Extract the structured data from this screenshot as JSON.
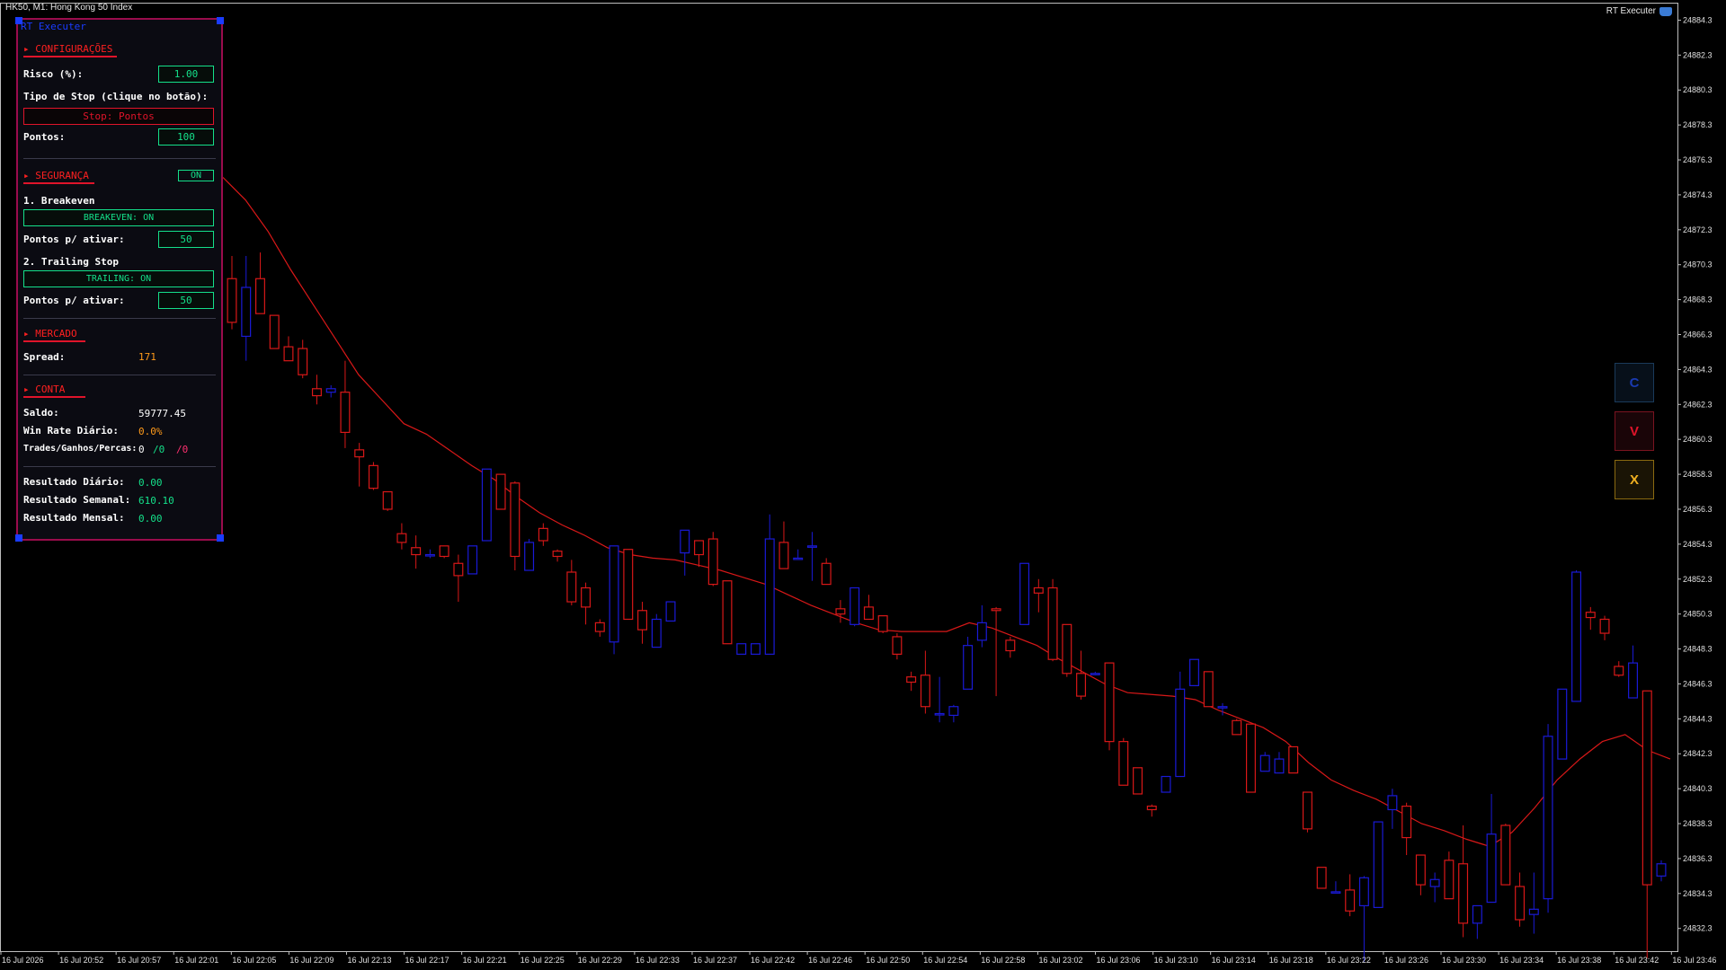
{
  "window": {
    "symbol_title": "HK50, M1:  Hong Kong 50 Index",
    "ea_name": "RT Executer"
  },
  "colors": {
    "bull": "#1a1ad6",
    "bear": "#d81818",
    "ma": "#d81818",
    "axis_text": "#e0e0e0",
    "panel_border": "#9a0c4c",
    "accent_green": "#14e08a",
    "accent_red": "#e0142a",
    "accent_orange": "#ff9a1a"
  },
  "panel": {
    "title": "RT Executer",
    "configuracoes": {
      "header": "▸ CONFIGURAÇÕES",
      "risco_label": "Risco (%):",
      "risco_value": "1.00",
      "tipo_stop_label": "Tipo de Stop (clique no botão):",
      "stop_button": "Stop: Pontos",
      "pontos_label": "Pontos:",
      "pontos_value": "100"
    },
    "seguranca": {
      "header": "▸ SEGURANÇA",
      "toggle": "ON",
      "breakeven_label": "1. Breakeven",
      "breakeven_button": "BREAKEVEN: ON",
      "be_pontos_label": "Pontos p/ ativar:",
      "be_pontos_value": "50",
      "trailing_label": "2. Trailing Stop",
      "trailing_button": "TRAILING: ON",
      "ts_pontos_label": "Pontos p/ ativar:",
      "ts_pontos_value": "50"
    },
    "mercado": {
      "header": "▸ MERCADO",
      "spread_label": "Spread:",
      "spread_value": "171"
    },
    "conta": {
      "header": "▸ CONTA",
      "saldo_label": "Saldo:",
      "saldo_value": "59777.45",
      "winrate_label": "Win Rate Diário:",
      "winrate_value": "0.0%",
      "trades_label": "Trades/Ganhos/Percas:",
      "trades_value": "0",
      "ganhos_value": "/0",
      "percas_value": "/0",
      "diario_label": "Resultado Diário:",
      "diario_value": "0.00",
      "semanal_label": "Resultado Semanal:",
      "semanal_value": "610.10",
      "mensal_label": "Resultado Mensal:",
      "mensal_value": "0.00"
    }
  },
  "buttons": {
    "c": "C",
    "v": "V",
    "x": "X"
  },
  "chart_data": {
    "type": "candlestick",
    "y_ticks": [
      "24884.3",
      "24882.3",
      "24880.3",
      "24878.3",
      "24876.3",
      "24874.3",
      "24872.3",
      "24870.3",
      "24868.3",
      "24866.3",
      "24864.3",
      "24862.3",
      "24860.3",
      "24858.3",
      "24856.3",
      "24854.3",
      "24852.3",
      "24850.3",
      "24848.3",
      "24846.3",
      "24844.3",
      "24842.3",
      "24840.3",
      "24838.3",
      "24836.3",
      "24834.3",
      "24832.3"
    ],
    "x_ticks": [
      "16 Jul 2026",
      "16 Jul 20:52",
      "16 Jul 20:57",
      "16 Jul 22:01",
      "16 Jul 22:05",
      "16 Jul 22:09",
      "16 Jul 22:13",
      "16 Jul 22:17",
      "16 Jul 22:21",
      "16 Jul 22:25",
      "16 Jul 22:29",
      "16 Jul 22:33",
      "16 Jul 22:37",
      "16 Jul 22:42",
      "16 Jul 22:46",
      "16 Jul 22:50",
      "16 Jul 22:54",
      "16 Jul 22:58",
      "16 Jul 23:02",
      "16 Jul 23:06",
      "16 Jul 23:10",
      "16 Jul 23:14",
      "16 Jul 23:18",
      "16 Jul 23:22",
      "16 Jul 23:26",
      "16 Jul 23:30",
      "16 Jul 23:34",
      "16 Jul 23:38",
      "16 Jul 23:42",
      "16 Jul 23:46"
    ],
    "y_range": [
      24831.0,
      24885.3
    ],
    "ma_series": [
      24875.3,
      24874.0,
      24872.2,
      24870.0,
      24868.0,
      24866.0,
      24864.0,
      24862.6,
      24861.2,
      24860.6,
      24859.7,
      24858.8,
      24858.0,
      24857.0,
      24856.1,
      24855.4,
      24854.8,
      24854.1,
      24853.7,
      24853.5,
      24853.4,
      24853.1,
      24852.8,
      24852.4,
      24852.0,
      24851.4,
      24850.8,
      24850.3,
      24849.8,
      24849.4,
      24849.3,
      24849.3,
      24849.3,
      24849.8,
      24849.5,
      24849.0,
      24848.5,
      24847.7,
      24847.0,
      24846.3,
      24845.8,
      24845.7,
      24845.6,
      24845.4,
      24844.8,
      24844.3,
      24843.8,
      24843.0,
      24841.8,
      24840.8,
      24840.2,
      24839.7,
      24839.0,
      24838.3,
      24837.9,
      24837.4,
      24837.0,
      24837.8,
      24839.2,
      24840.8,
      24842.0,
      24843.0,
      24843.4,
      24842.5,
      24842.0
    ],
    "candles": [
      [
        24869.5,
        24870.8,
        24866.6,
        24867.0
      ],
      [
        24866.2,
        24870.8,
        24864.8,
        24869.0
      ],
      [
        24869.5,
        24871.0,
        24867.5,
        24867.5
      ],
      [
        24867.4,
        24867.4,
        24865.5,
        24865.5
      ],
      [
        24865.6,
        24866.2,
        24864.8,
        24864.8
      ],
      [
        24865.5,
        24866.0,
        24863.8,
        24864.0
      ],
      [
        24863.2,
        24864.0,
        24862.3,
        24862.8
      ],
      [
        24863.0,
        24863.4,
        24862.7,
        24863.2
      ],
      [
        24863.0,
        24864.8,
        24859.8,
        24860.7
      ],
      [
        24859.7,
        24860.1,
        24857.6,
        24859.3
      ],
      [
        24858.8,
        24859.0,
        24857.4,
        24857.5
      ],
      [
        24857.3,
        24857.3,
        24856.2,
        24856.3
      ],
      [
        24854.9,
        24855.5,
        24854.0,
        24854.4
      ],
      [
        24854.1,
        24854.8,
        24852.9,
        24853.7
      ],
      [
        24853.7,
        24854.0,
        24853.5,
        24853.7
      ],
      [
        24854.2,
        24854.2,
        24853.5,
        24853.6
      ],
      [
        24853.2,
        24853.7,
        24851.0,
        24852.5
      ],
      [
        24852.6,
        24854.2,
        24852.6,
        24854.2
      ],
      [
        24854.5,
        24858.6,
        24854.5,
        24858.6
      ],
      [
        24858.3,
        24858.3,
        24856.3,
        24856.3
      ],
      [
        24857.8,
        24857.9,
        24852.8,
        24853.6
      ],
      [
        24852.8,
        24854.6,
        24852.8,
        24854.4
      ],
      [
        24855.2,
        24855.5,
        24854.2,
        24854.5
      ],
      [
        24853.9,
        24854.0,
        24853.3,
        24853.6
      ],
      [
        24852.7,
        24853.4,
        24850.8,
        24851.0
      ],
      [
        24851.8,
        24852.1,
        24849.7,
        24850.7
      ],
      [
        24849.8,
        24850.0,
        24849.0,
        24849.3
      ],
      [
        24848.7,
        24854.2,
        24848.0,
        24854.2
      ],
      [
        24854.0,
        24854.0,
        24850.0,
        24850.0
      ],
      [
        24850.5,
        24851.0,
        24848.6,
        24849.4
      ],
      [
        24848.4,
        24850.3,
        24848.4,
        24850.0
      ],
      [
        24849.9,
        24851.0,
        24849.9,
        24851.0
      ],
      [
        24853.8,
        24855.1,
        24852.5,
        24855.1
      ],
      [
        24854.5,
        24854.5,
        24853.0,
        24853.7
      ],
      [
        24854.6,
        24855.0,
        24851.9,
        24852.0
      ],
      [
        24852.2,
        24852.2,
        24848.6,
        24848.6
      ],
      [
        24848.0,
        24848.6,
        24848.0,
        24848.6
      ],
      [
        24848.0,
        24848.6,
        24848.0,
        24848.6
      ],
      [
        24848.0,
        24856.0,
        24848.0,
        24854.6
      ],
      [
        24854.4,
        24855.6,
        24852.9,
        24852.9
      ],
      [
        24853.5,
        24854.0,
        24853.5,
        24853.5
      ],
      [
        24854.2,
        24855.0,
        24852.2,
        24854.2
      ],
      [
        24853.2,
        24853.5,
        24852.0,
        24852.0
      ],
      [
        24850.6,
        24851.1,
        24849.8,
        24850.3
      ],
      [
        24849.7,
        24851.8,
        24849.6,
        24851.8
      ],
      [
        24850.7,
        24851.4,
        24850.0,
        24850.0
      ],
      [
        24850.2,
        24850.2,
        24849.2,
        24849.3
      ],
      [
        24849.0,
        24849.2,
        24847.7,
        24848.0
      ],
      [
        24846.7,
        24847.0,
        24845.9,
        24846.4
      ],
      [
        24846.8,
        24848.2,
        24844.6,
        24845.0
      ],
      [
        24844.6,
        24846.7,
        24844.1,
        24844.6
      ],
      [
        24844.5,
        24845.1,
        24844.1,
        24845.0
      ],
      [
        24846.0,
        24849.0,
        24846.0,
        24848.5
      ],
      [
        24848.8,
        24850.8,
        24848.4,
        24849.8
      ],
      [
        24850.6,
        24850.7,
        24845.6,
        24850.5
      ],
      [
        24848.8,
        24849.0,
        24847.8,
        24848.2
      ],
      [
        24849.7,
        24853.2,
        24849.7,
        24853.2
      ],
      [
        24851.8,
        24852.3,
        24850.4,
        24851.5
      ],
      [
        24851.8,
        24852.3,
        24847.6,
        24847.7
      ],
      [
        24849.7,
        24849.7,
        24846.7,
        24846.9
      ],
      [
        24846.9,
        24848.2,
        24845.4,
        24845.6
      ],
      [
        24846.9,
        24847.0,
        24846.8,
        24846.9
      ],
      [
        24847.5,
        24847.5,
        24842.5,
        24843.0
      ],
      [
        24843.0,
        24843.2,
        24840.5,
        24840.5
      ],
      [
        24841.5,
        24841.5,
        24840.0,
        24840.0
      ],
      [
        24839.3,
        24839.4,
        24838.7,
        24839.1
      ],
      [
        24840.1,
        24841.0,
        24840.1,
        24841.0
      ],
      [
        24841.0,
        24847.0,
        24841.0,
        24846.0
      ],
      [
        24846.2,
        24847.7,
        24846.2,
        24847.7
      ],
      [
        24847.0,
        24847.0,
        24845.0,
        24845.0
      ],
      [
        24845.0,
        24845.2,
        24844.5,
        24845.0
      ],
      [
        24844.2,
        24844.3,
        24843.4,
        24843.4
      ],
      [
        24844.0,
        24844.0,
        24840.1,
        24840.1
      ],
      [
        24841.3,
        24842.4,
        24841.3,
        24842.2
      ],
      [
        24841.2,
        24842.4,
        24841.2,
        24842.0
      ],
      [
        24842.7,
        24842.7,
        24841.2,
        24841.2
      ],
      [
        24840.1,
        24840.1,
        24837.8,
        24838.0
      ],
      [
        24835.8,
        24835.8,
        24834.6,
        24834.6
      ],
      [
        24834.4,
        24835.0,
        24834.4,
        24834.4
      ],
      [
        24834.5,
        24835.4,
        24833.0,
        24833.3
      ],
      [
        24833.6,
        24835.3,
        24830.4,
        24835.2
      ],
      [
        24833.5,
        24838.4,
        24833.5,
        24838.4
      ],
      [
        24839.1,
        24840.3,
        24838.0,
        24839.9
      ],
      [
        24839.3,
        24839.5,
        24836.5,
        24837.5
      ],
      [
        24836.5,
        24836.5,
        24834.2,
        24834.8
      ],
      [
        24834.7,
        24835.5,
        24833.8,
        24835.1
      ],
      [
        24836.2,
        24836.7,
        24834.0,
        24834.0
      ],
      [
        24836.0,
        24838.2,
        24831.8,
        24832.6
      ],
      [
        24832.6,
        24833.6,
        24831.7,
        24833.6
      ],
      [
        24833.8,
        24840.0,
        24833.8,
        24837.7
      ],
      [
        24838.2,
        24838.3,
        24834.8,
        24834.8
      ],
      [
        24834.7,
        24835.5,
        24832.4,
        24832.8
      ],
      [
        24833.1,
        24835.5,
        24832.0,
        24833.4
      ],
      [
        24834.0,
        24844.0,
        24833.2,
        24843.3
      ],
      [
        24842.0,
        24846.0,
        24842.0,
        24846.0
      ],
      [
        24845.3,
        24852.8,
        24845.3,
        24852.7
      ],
      [
        24850.4,
        24850.7,
        24849.4,
        24850.1
      ],
      [
        24850.0,
        24850.2,
        24848.8,
        24849.2
      ],
      [
        24847.3,
        24847.6,
        24846.7,
        24846.8
      ],
      [
        24845.5,
        24848.5,
        24845.5,
        24847.5
      ],
      [
        24845.9,
        24845.9,
        24830.6,
        24834.8
      ],
      [
        24835.3,
        24836.2,
        24835.0,
        24836.0
      ]
    ]
  }
}
